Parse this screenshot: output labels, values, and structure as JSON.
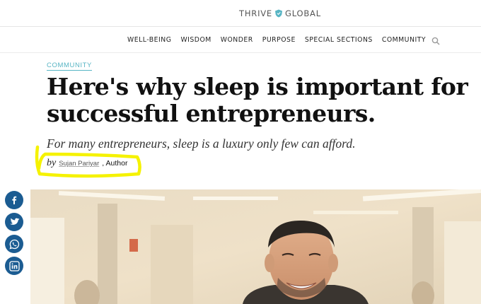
{
  "header": {
    "logo_left": "THRIVE",
    "logo_right": "GLOBAL",
    "logo_color": "#58b5c4"
  },
  "nav": {
    "items": [
      "WELL-BEING",
      "WISDOM",
      "WONDER",
      "PURPOSE",
      "SPECIAL SECTIONS",
      "COMMUNITY"
    ],
    "search_icon": "search-icon"
  },
  "article": {
    "category": "COMMUNITY",
    "headline_line1": "Here's why sleep is important for",
    "headline_line2": "successful entrepreneurs.",
    "subhead": "For many entrepreneurs, sleep is a luxury only few can afford.",
    "by_word": "by",
    "author_name": "Sujan Pariyar",
    "author_role": ", Author"
  },
  "share": {
    "icons": [
      "facebook-icon",
      "twitter-icon",
      "whatsapp-icon",
      "linkedin-icon"
    ],
    "color": "#1b5c92"
  },
  "annotation": {
    "highlight_color": "#f5f200"
  }
}
